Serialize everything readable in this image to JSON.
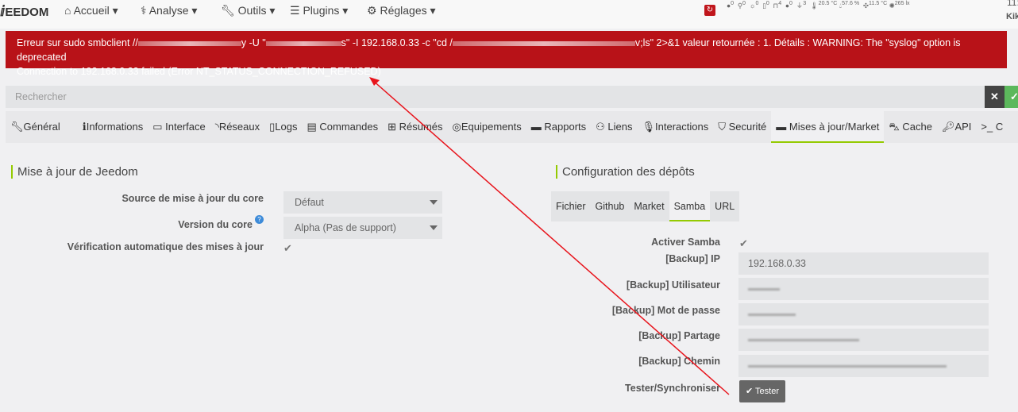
{
  "nav": {
    "logo": "EEDOM",
    "menu": [
      "Accueil",
      "Analyse",
      "Outils",
      "Plugins",
      "Réglages"
    ],
    "status": [
      "0",
      "0",
      "0",
      "0",
      "4",
      "0",
      "3",
      "20.5 °C",
      "57.6 %",
      "11.5 °C",
      "265 lx"
    ],
    "clock": "11:",
    "user": "Kik"
  },
  "alert": {
    "l1a": "Erreur sur sudo smbclient //",
    "l1b": "y -U \"",
    "l1c": "s\" -I 192.168.0.33 -c \"cd /",
    "l1d": "v;ls\" 2>&1 valeur retournée : 1. Détails : WARNING: The \"syslog\" option is deprecated",
    "l2": "Connection to 192.168.0.33 failed (Error NT_STATUS_CONNECTION_REFUSED)"
  },
  "search": {
    "placeholder": "Rechercher"
  },
  "tabs": [
    "Général",
    "Informations",
    "Interface",
    "Réseaux",
    "Logs",
    "Commandes",
    "Résumés",
    "Equipements",
    "Rapports",
    "Liens",
    "Interactions",
    "Securité",
    "Mises à jour/Market",
    "Cache",
    "API",
    "C"
  ],
  "left": {
    "title": "Mise à jour de Jeedom",
    "source_label": "Source de mise à jour du core",
    "source_value": "Défaut",
    "version_label": "Version du core",
    "version_value": "Alpha (Pas de support)",
    "auto_label": "Vérification automatique des mises à jour"
  },
  "right": {
    "title": "Configuration des dépôts",
    "subtabs": [
      "Fichier",
      "Github",
      "Market",
      "Samba",
      "URL"
    ],
    "enable_label": "Activer Samba",
    "ip_label": "[Backup] IP",
    "ip_value": "192.168.0.33",
    "user_label": "[Backup] Utilisateur",
    "pass_label": "[Backup] Mot de passe",
    "share_label": "[Backup] Partage",
    "path_label": "[Backup] Chemin",
    "test_label": "Tester/Synchroniser",
    "test_button": "Tester"
  },
  "colors": {
    "accent": "#94ca02",
    "error": "#b81218"
  }
}
